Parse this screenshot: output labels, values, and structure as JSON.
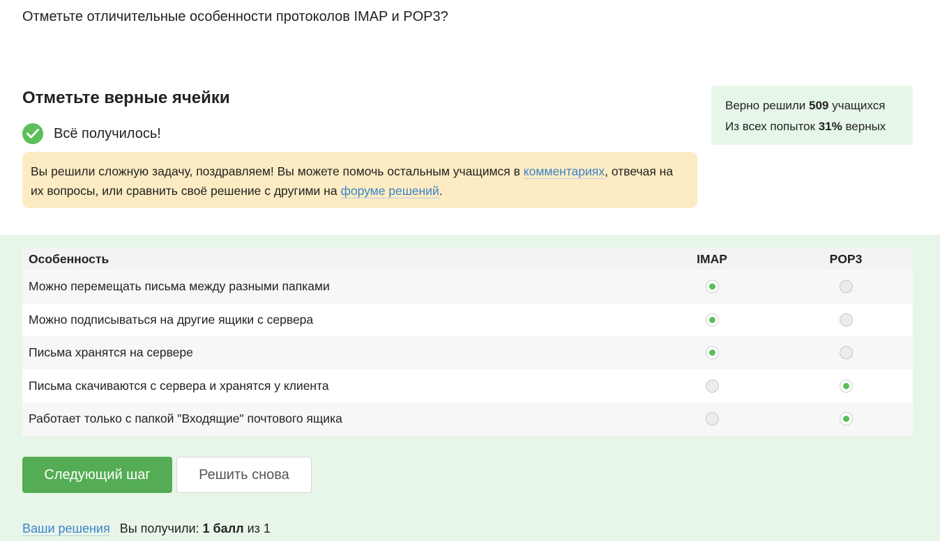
{
  "question": "Отметьте отличительные особенности протоколов IMAP и POP3?",
  "heading": "Отметьте верные ячейки",
  "success": {
    "text": "Всё получилось!",
    "icon": "check-circle-icon",
    "color": "#5bbf5a"
  },
  "notice": {
    "part1": "Вы решили сложную задачу, поздравляем! Вы можете помочь остальным учащимся в ",
    "link1": "комментариях",
    "part2": ", отвечая на их вопросы, или сравнить своё решение с другими на ",
    "link2": "форуме решений",
    "part3": "."
  },
  "stats": {
    "line1_prefix": "Верно решили ",
    "line1_value": "509",
    "line1_suffix": " учащихся",
    "line2_prefix": "Из всех попыток ",
    "line2_value": "31%",
    "line2_suffix": " верных"
  },
  "table": {
    "headers": [
      "Особенность",
      "IMAP",
      "POP3"
    ],
    "rows": [
      {
        "feature": "Можно перемещать письма между разными папками",
        "imap": true,
        "pop3": false
      },
      {
        "feature": "Можно подписываться на другие ящики с сервера",
        "imap": true,
        "pop3": false
      },
      {
        "feature": "Письма хранятся на сервере",
        "imap": true,
        "pop3": false
      },
      {
        "feature": "Письма скачиваются с сервера и хранятся у клиента",
        "imap": false,
        "pop3": true
      },
      {
        "feature": "Работает только с папкой \"Входящие\" почтового ящика",
        "imap": false,
        "pop3": true
      }
    ]
  },
  "buttons": {
    "next": "Следующий шаг",
    "retry": "Решить снова"
  },
  "footer": {
    "link": "Ваши решения",
    "prefix": "Вы получили: ",
    "score": "1 балл",
    "suffix": " из 1"
  },
  "colors": {
    "accent": "#54ad54",
    "link": "#3b82c9",
    "notice_bg": "#fdecc3",
    "stats_bg": "#e6f6e8",
    "area_bg": "#e8f6e9"
  }
}
